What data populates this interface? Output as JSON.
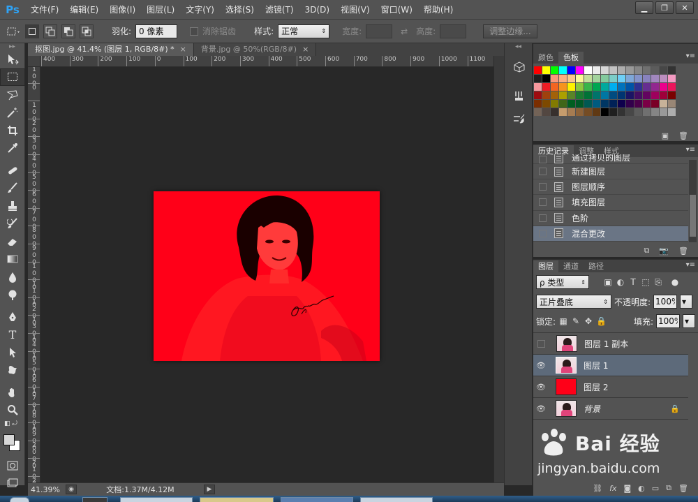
{
  "app": {
    "logo": "Ps",
    "menus": [
      "文件(F)",
      "编辑(E)",
      "图像(I)",
      "图层(L)",
      "文字(Y)",
      "选择(S)",
      "滤镜(T)",
      "3D(D)",
      "视图(V)",
      "窗口(W)",
      "帮助(H)"
    ],
    "window_controls": {
      "minimize": "▁",
      "restore": "❐",
      "close": "✕"
    }
  },
  "options_bar": {
    "feather_label": "羽化:",
    "feather_value": "0 像素",
    "antialias_label": "消除锯齿",
    "style_label": "样式:",
    "style_value": "正常",
    "width_label": "宽度:",
    "height_label": "高度:",
    "refine_edge_label": "调整边缘..."
  },
  "documents": {
    "tabs": [
      {
        "label": "抠图.jpg @ 41.4% (图层 1, RGB/8#) *",
        "close": "×"
      },
      {
        "label": "背景.jpg @ 50%(RGB/8#)",
        "close": "×"
      }
    ],
    "ruler_h_labels": [
      "400",
      "300",
      "200",
      "100",
      "0",
      "100",
      "200",
      "300",
      "400",
      "500",
      "600",
      "700",
      "800",
      "900",
      "1000",
      "1100"
    ],
    "ruler_v_labels": [
      "100",
      "0",
      "100",
      "200",
      "300",
      "400",
      "500",
      "600",
      "700",
      "800",
      "900",
      "1000",
      "1100",
      "1200",
      "1300",
      "1400",
      "1500",
      "1600",
      "1700",
      "1800",
      "1900",
      "2000",
      "2100",
      "2200"
    ],
    "fill_color": "#ff0018"
  },
  "status_bar": {
    "zoom": "41.39%",
    "doc_size": "文档:1.37M/4.12M"
  },
  "swatches": {
    "tabs": [
      "颜色",
      "色板"
    ],
    "colors": [
      "#ff0000",
      "#ffff00",
      "#00ff00",
      "#00ffff",
      "#0000ff",
      "#ff00ff",
      "#ffffff",
      "#ebebeb",
      "#d6d6d6",
      "#c2c2c2",
      "#adadad",
      "#999999",
      "#858585",
      "#707070",
      "#5c5c5c",
      "#474747",
      "#333333",
      "#1f1f1f",
      "#000000",
      "#f7977a",
      "#fbad82",
      "#fdc68c",
      "#fff79a",
      "#c4df9b",
      "#a2d39c",
      "#82ca9d",
      "#7bcdc8",
      "#6ecff6",
      "#7ea7d8",
      "#8493ca",
      "#8882be",
      "#a187be",
      "#bc8dbf",
      "#f49ac2",
      "#f6989d",
      "#ed1c24",
      "#f26522",
      "#f7941d",
      "#fff200",
      "#8dc73f",
      "#39b54a",
      "#00a651",
      "#00a99d",
      "#00aeef",
      "#0072bc",
      "#0054a6",
      "#2e3192",
      "#662d91",
      "#92278f",
      "#ec008c",
      "#ed145b",
      "#9e0b0f",
      "#a0410d",
      "#a36209",
      "#aba000",
      "#598527",
      "#1a7b30",
      "#007236",
      "#00746b",
      "#0076a3",
      "#004b80",
      "#003471",
      "#1b1464",
      "#440e62",
      "#630460",
      "#9e005d",
      "#9e0039",
      "#790000",
      "#7b2e00",
      "#7d4900",
      "#827b00",
      "#406618",
      "#005e20",
      "#005826",
      "#005952",
      "#005b7f",
      "#003663",
      "#002157",
      "#0d004c",
      "#32004b",
      "#4b0049",
      "#7b0046",
      "#7a0026",
      "#c7b299",
      "#998675",
      "#736357",
      "#534741",
      "#37302d",
      "#c69c6d",
      "#a67c52",
      "#8c6239",
      "#754c24",
      "#603913",
      "#000000",
      "#1f1f1f",
      "#333333",
      "#474747",
      "#5c5c5c",
      "#707070",
      "#858585",
      "#999999",
      "#adadad"
    ]
  },
  "history": {
    "tabs": [
      "历史记录",
      "调整",
      "样式"
    ],
    "items": [
      "通过拷贝的图层",
      "新建图层",
      "图层顺序",
      "填充图层",
      "色阶",
      "混合更改"
    ]
  },
  "layers": {
    "tabs": [
      "图层",
      "通道",
      "路径"
    ],
    "filter_type": "ρ 类型",
    "blend_mode": "正片叠底",
    "opacity_label": "不透明度:",
    "opacity_value": "100%",
    "lock_label": "锁定:",
    "fill_label": "填充:",
    "fill_value": "100%",
    "items": [
      {
        "name": "图层 1 副本",
        "visible": false,
        "thumb": "photo"
      },
      {
        "name": "图层 1",
        "visible": true,
        "thumb": "photo",
        "selected": true
      },
      {
        "name": "图层 2",
        "visible": true,
        "thumb": "red"
      },
      {
        "name": "背景",
        "visible": true,
        "thumb": "photo",
        "locked": true
      }
    ]
  },
  "watermark": {
    "brand": "Bai 经验",
    "url": "jingyan.baidu.com"
  }
}
